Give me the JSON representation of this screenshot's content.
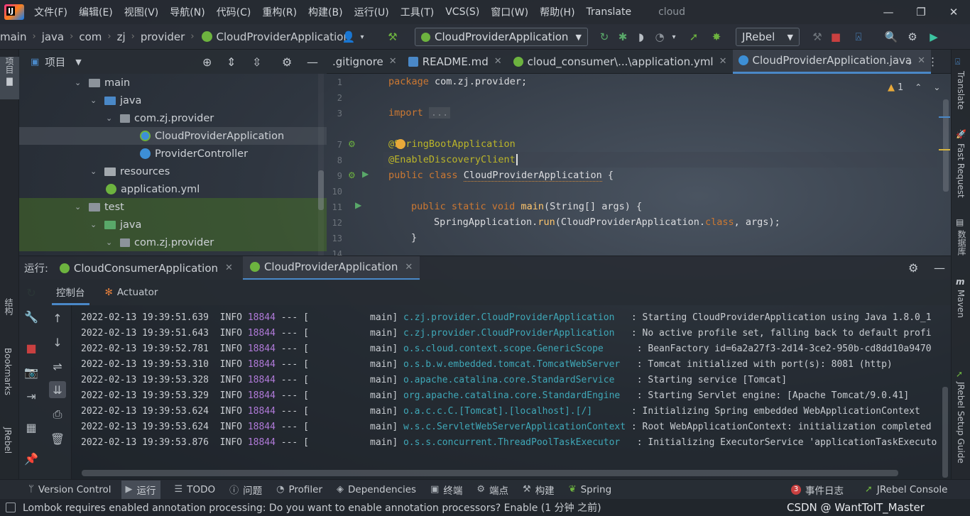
{
  "menu": {
    "items": [
      "文件(F)",
      "编辑(E)",
      "视图(V)",
      "导航(N)",
      "代码(C)",
      "重构(R)",
      "构建(B)",
      "运行(U)",
      "工具(T)",
      "VCS(S)",
      "窗口(W)",
      "帮助(H)",
      "Translate"
    ],
    "project_name": "cloud"
  },
  "nav": {
    "crumbs": [
      "main",
      "java",
      "com",
      "zj",
      "provider",
      "CloudProviderApplication"
    ],
    "run_config": "CloudProviderApplication",
    "jrebel": "JRebel"
  },
  "project_panel": {
    "title": "项目",
    "tree": [
      {
        "label": "main",
        "type": "folder",
        "depth": 3,
        "expanded": true
      },
      {
        "label": "java",
        "type": "src-folder",
        "depth": 4,
        "expanded": true
      },
      {
        "label": "com.zj.provider",
        "type": "package",
        "depth": 5,
        "expanded": true
      },
      {
        "label": "CloudProviderApplication",
        "type": "spring-class",
        "depth": 6,
        "selected": true
      },
      {
        "label": "ProviderController",
        "type": "class",
        "depth": 6
      },
      {
        "label": "resources",
        "type": "res-folder",
        "depth": 4,
        "expanded": true
      },
      {
        "label": "application.yml",
        "type": "yml",
        "depth": 5
      },
      {
        "label": "test",
        "type": "folder",
        "depth": 3,
        "expanded": true
      },
      {
        "label": "java",
        "type": "test-folder",
        "depth": 4,
        "expanded": true
      },
      {
        "label": "com.zj.provider",
        "type": "package",
        "depth": 5,
        "expanded": true
      }
    ]
  },
  "editor": {
    "tabs": [
      {
        "label": ".gitignore",
        "active": false
      },
      {
        "label": "README.md",
        "active": false
      },
      {
        "label": "cloud_consumer\\...\\application.yml",
        "active": false
      },
      {
        "label": "CloudProviderApplication.java",
        "active": true
      }
    ],
    "warnings": "1",
    "line_numbers": [
      "1",
      "2",
      "3",
      "7",
      "8",
      "9",
      "10",
      "11",
      "12",
      "13",
      "14"
    ],
    "lines": {
      "l1_kw": "package",
      "l1_rest": " com.zj.provider;",
      "l3_kw": "import",
      "l3_fold": "...",
      "l7": "@SpringBootApplication",
      "l8": "@EnableDiscoveryClient",
      "l9_kw": "public class",
      "l9_name": "CloudProviderApplication",
      "l9_rest": " {",
      "l11_kw": "public static void",
      "l11_fn": "main",
      "l11_rest": "(String[] args) {",
      "l12_a": "SpringApplication.",
      "l12_fn": "run",
      "l12_b": "(CloudProviderApplication.",
      "l12_kw": "class",
      "l12_c": ", args);",
      "l13": "}"
    }
  },
  "run_panel": {
    "label": "运行:",
    "tabs": [
      {
        "label": "CloudConsumerApplication",
        "active": false
      },
      {
        "label": "CloudProviderApplication",
        "active": true
      }
    ],
    "subtabs": [
      "控制台",
      "Actuator"
    ]
  },
  "console": {
    "lines": [
      {
        "ts": "2022-02-13 19:39:51.639",
        "lvl": "INFO",
        "pid": "18844",
        "sep": "--- [",
        "thread": "main]",
        "logger": "c.zj.provider.CloudProviderApplication  ",
        "msg": " : Starting CloudProviderApplication using Java 1.8.0_1"
      },
      {
        "ts": "2022-02-13 19:39:51.643",
        "lvl": "INFO",
        "pid": "18844",
        "sep": "--- [",
        "thread": "main]",
        "logger": "c.zj.provider.CloudProviderApplication  ",
        "msg": " : No active profile set, falling back to default profi"
      },
      {
        "ts": "2022-02-13 19:39:52.781",
        "lvl": "INFO",
        "pid": "18844",
        "sep": "--- [",
        "thread": "main]",
        "logger": "o.s.cloud.context.scope.GenericScope     ",
        "msg": " : BeanFactory id=6a2a27f3-2d14-3ce2-950b-cd8dd10a9470"
      },
      {
        "ts": "2022-02-13 19:39:53.310",
        "lvl": "INFO",
        "pid": "18844",
        "sep": "--- [",
        "thread": "main]",
        "logger": "o.s.b.w.embedded.tomcat.TomcatWebServer  ",
        "msg": " : Tomcat initialized with port(s): 8081 (http)"
      },
      {
        "ts": "2022-02-13 19:39:53.328",
        "lvl": "INFO",
        "pid": "18844",
        "sep": "--- [",
        "thread": "main]",
        "logger": "o.apache.catalina.core.StandardService   ",
        "msg": " : Starting service [Tomcat]"
      },
      {
        "ts": "2022-02-13 19:39:53.329",
        "lvl": "INFO",
        "pid": "18844",
        "sep": "--- [",
        "thread": "main]",
        "logger": "org.apache.catalina.core.StandardEngine  ",
        "msg": " : Starting Servlet engine: [Apache Tomcat/9.0.41]"
      },
      {
        "ts": "2022-02-13 19:39:53.624",
        "lvl": "INFO",
        "pid": "18844",
        "sep": "--- [",
        "thread": "main]",
        "logger": "o.a.c.c.C.[Tomcat].[localhost].[/]      ",
        "msg": " : Initializing Spring embedded WebApplicationContext"
      },
      {
        "ts": "2022-02-13 19:39:53.624",
        "lvl": "INFO",
        "pid": "18844",
        "sep": "--- [",
        "thread": "main]",
        "logger": "w.s.c.ServletWebServerApplicationContext ",
        "msg": ": Root WebApplicationContext: initialization completed"
      },
      {
        "ts": "2022-02-13 19:39:53.876",
        "lvl": "INFO",
        "pid": "18844",
        "sep": "--- [",
        "thread": "main]",
        "logger": "o.s.s.concurrent.ThreadPoolTaskExecutor  ",
        "msg": " : Initializing ExecutorService 'applicationTaskExecuto"
      }
    ]
  },
  "left_strip": [
    "项目",
    "结构",
    "Bookmarks",
    "JRebel"
  ],
  "right_strip": [
    "Translate",
    "Fast Request",
    "数据库",
    "Maven",
    "JRebel Setup Guide"
  ],
  "status_bar": {
    "items": [
      "Version Control",
      "运行",
      "TODO",
      "问题",
      "Profiler",
      "Dependencies",
      "终端",
      "端点",
      "构建",
      "Spring"
    ],
    "right_items": [
      "事件日志",
      "JRebel Console"
    ],
    "event_count": "3"
  },
  "message": {
    "text": "Lombok requires enabled annotation processing: Do you want to enable annotation processors? Enable (1 分钟 之前)",
    "watermark": "CSDN @ WantToIT_Master"
  },
  "colors": {
    "accent": "#4a88c7",
    "spring": "#6db33f",
    "pid": "#b07ad9",
    "logger": "#3fa8b8"
  }
}
